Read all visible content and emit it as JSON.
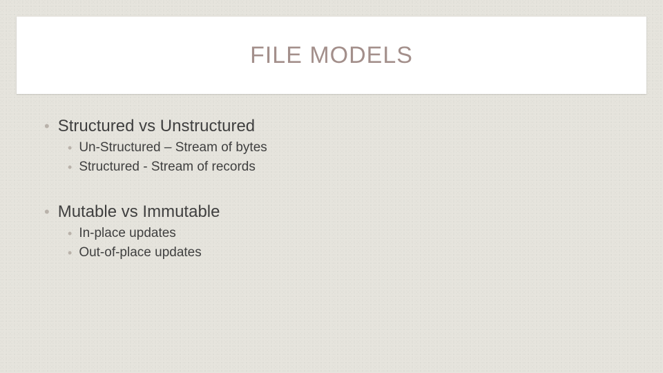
{
  "title": "FILE MODELS",
  "bullets": [
    {
      "text": "Structured vs Unstructured",
      "children": [
        {
          "text": "Un-Structured – Stream of bytes"
        },
        {
          "text": "Structured -  Stream of records"
        }
      ]
    },
    {
      "text": "Mutable vs Immutable",
      "children": [
        {
          "text": "In-place updates"
        },
        {
          "text": "Out-of-place updates"
        }
      ]
    }
  ]
}
